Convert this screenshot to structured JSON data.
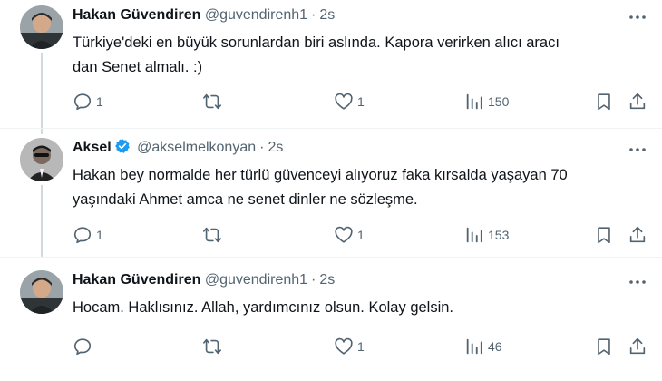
{
  "tweets": [
    {
      "name": "Hakan Güvendiren",
      "handle": "@guvendirenh1",
      "time": "2s",
      "text_line1": "Türkiye'deki en büyük sorunlardan biri aslında. Kapora verirken alıcı aracı",
      "text_line2": "dan Senet almalı. :)",
      "replies": "1",
      "retweets": "",
      "likes": "1",
      "views": "150",
      "verified": false
    },
    {
      "name": "Aksel",
      "handle": "@akselmelkonyan",
      "time": "2s",
      "text_line1": "Hakan bey normalde her türlü güvenceyi alıyoruz faka kırsalda yaşayan 70",
      "text_line2": "yaşındaki Ahmet amca ne senet dinler ne sözleşme.",
      "replies": "1",
      "retweets": "",
      "likes": "1",
      "views": "153",
      "verified": true
    },
    {
      "name": "Hakan Güvendiren",
      "handle": "@guvendirenh1",
      "time": "2s",
      "text_line1": "Hocam. Haklısınız. Allah, yardımcınız olsun. Kolay gelsin.",
      "text_line2": "",
      "replies": "",
      "retweets": "",
      "likes": "1",
      "views": "46",
      "verified": false
    }
  ],
  "separator": "·",
  "colors": {
    "text": "#0f1419",
    "muted": "#536471",
    "verified": "#1d9bf0",
    "thread_line": "#cfd9de"
  },
  "icons": [
    "reply-icon",
    "retweet-icon",
    "like-icon",
    "views-icon",
    "bookmark-icon",
    "share-icon",
    "more-icon",
    "verified-badge-icon"
  ]
}
